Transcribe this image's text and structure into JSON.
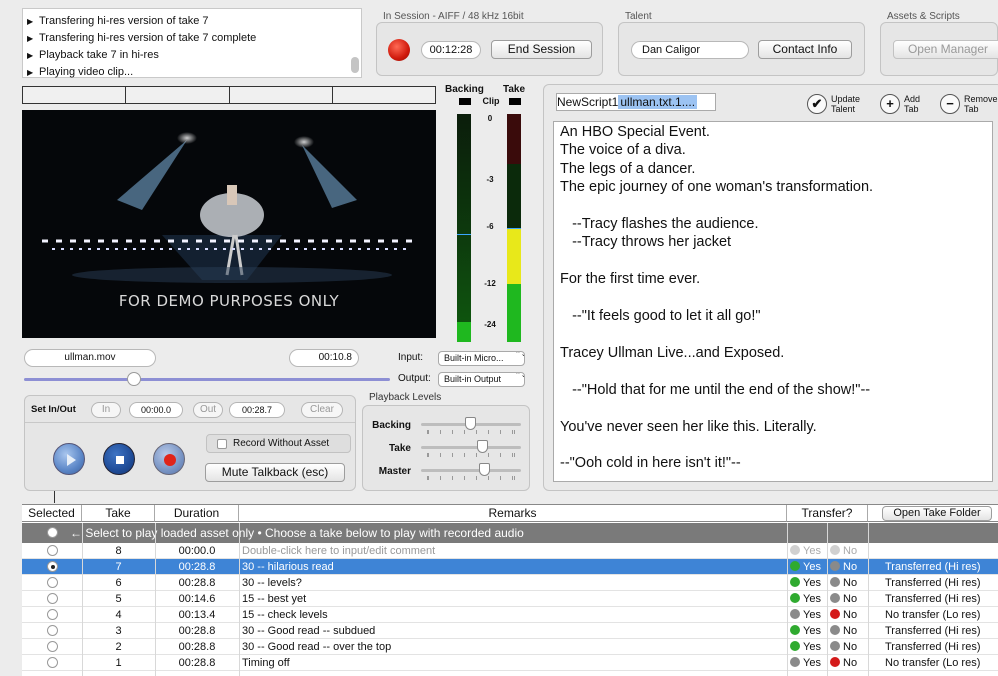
{
  "log": {
    "lines": [
      "Transfering hi-res version of take 7",
      "Transfering hi-res version of take 7 complete",
      "Playback take 7 in hi-res",
      "Playing video clip..."
    ]
  },
  "session": {
    "title": "In Session - AIFF / 48 kHz 16bit",
    "timer": "00:12:28",
    "end_label": "End Session"
  },
  "talent": {
    "title": "Talent",
    "name": "Dan Caligor",
    "contact_label": "Contact Info"
  },
  "assets": {
    "title": "Assets & Scripts",
    "open_manager_label": "Open Manager"
  },
  "video": {
    "overlay_text": "FOR DEMO PURPOSES ONLY",
    "filename": "ullman.mov",
    "timecode": "00:10.8",
    "scrub_position": 0.3
  },
  "meters": {
    "backing_label": "Backing",
    "take_label": "Take",
    "clip_label": "Clip",
    "scale": [
      "0",
      "-3",
      "-6",
      "-12",
      "-24"
    ]
  },
  "io": {
    "input_label": "Input:",
    "input_value": "Built-in Micro...",
    "output_label": "Output:",
    "output_value": "Built-in Output"
  },
  "inout": {
    "label": "Set In/Out",
    "in_label": "In",
    "in_value": "00:00.0",
    "out_label": "Out",
    "out_value": "00:28.7",
    "clear_label": "Clear"
  },
  "record": {
    "without_asset_label": "Record Without Asset",
    "mute_label": "Mute Talkback (esc)"
  },
  "levels": {
    "title": "Playback Levels",
    "items": [
      {
        "label": "Backing",
        "value": 0.5
      },
      {
        "label": "Take",
        "value": 0.62
      },
      {
        "label": "Master",
        "value": 0.64
      }
    ]
  },
  "script": {
    "tab1": "NewScript1",
    "tab2": "ullman.txt.1....",
    "update_talent": "Update Talent",
    "add_tab": "Add Tab",
    "remove_tab": "Remove Tab",
    "lines": [
      "An HBO Special Event.",
      "The voice of a diva.",
      "The legs of a dancer.",
      "The epic journey of one woman's transformation.",
      "",
      "   --Tracy flashes the audience.",
      "   --Tracy throws her jacket",
      "",
      "For the first time ever.",
      "",
      "   --\"It feels good to let it all go!\"",
      "",
      "Tracey Ullman Live...and Exposed.",
      "",
      "   --\"Hold that for me until the end of the show!\"--",
      "",
      "You've never seen her like this. Literally.",
      "",
      "--\"Ooh cold in here isn't it!\"--"
    ]
  },
  "takes": {
    "headers": {
      "selected": "Selected",
      "take": "Take",
      "duration": "Duration",
      "remarks": "Remarks",
      "transfer": "Transfer?",
      "open_folder": "Open Take Folder"
    },
    "note": "← Select to play loaded asset only • Choose a take below to play with recorded audio",
    "yes": "Yes",
    "no": "No",
    "rows": [
      {
        "take": "8",
        "duration": "00:00.0",
        "remarks": "Double-click here to input/edit comment",
        "status": "",
        "yes_color": "#d0d0d0",
        "no_color": "#d0d0d0",
        "selected": false,
        "placeholder": true
      },
      {
        "take": "7",
        "duration": "00:28.8",
        "remarks": "30 -- hilarious read",
        "status": "Transferred (Hi res)",
        "yes_color": "#2faa2f",
        "no_color": "#8a8a8a",
        "selected": true,
        "placeholder": false
      },
      {
        "take": "6",
        "duration": "00:28.8",
        "remarks": "30 -- levels?",
        "status": "Transferred (Hi res)",
        "yes_color": "#2faa2f",
        "no_color": "#8a8a8a",
        "selected": false,
        "placeholder": false
      },
      {
        "take": "5",
        "duration": "00:14.6",
        "remarks": "15 -- best yet",
        "status": "Transferred (Hi res)",
        "yes_color": "#2faa2f",
        "no_color": "#8a8a8a",
        "selected": false,
        "placeholder": false
      },
      {
        "take": "4",
        "duration": "00:13.4",
        "remarks": "15 -- check levels",
        "status": "No transfer (Lo res)",
        "yes_color": "#8a8a8a",
        "no_color": "#d41a1a",
        "selected": false,
        "placeholder": false
      },
      {
        "take": "3",
        "duration": "00:28.8",
        "remarks": "30 -- Good read -- subdued",
        "status": "Transferred (Hi res)",
        "yes_color": "#2faa2f",
        "no_color": "#8a8a8a",
        "selected": false,
        "placeholder": false
      },
      {
        "take": "2",
        "duration": "00:28.8",
        "remarks": "30 -- Good read -- over the top",
        "status": "Transferred (Hi res)",
        "yes_color": "#2faa2f",
        "no_color": "#8a8a8a",
        "selected": false,
        "placeholder": false
      },
      {
        "take": "1",
        "duration": "00:28.8",
        "remarks": "Timing off",
        "status": "No transfer (Lo res)",
        "yes_color": "#8a8a8a",
        "no_color": "#d41a1a",
        "selected": false,
        "placeholder": false
      }
    ]
  },
  "colors": {
    "selection": "#3e84d6",
    "meter_green": "#1fb81f",
    "meter_yellow": "#e8e81a",
    "record_red": "#d01a0c",
    "transport_blue": "#2d5aa8"
  }
}
